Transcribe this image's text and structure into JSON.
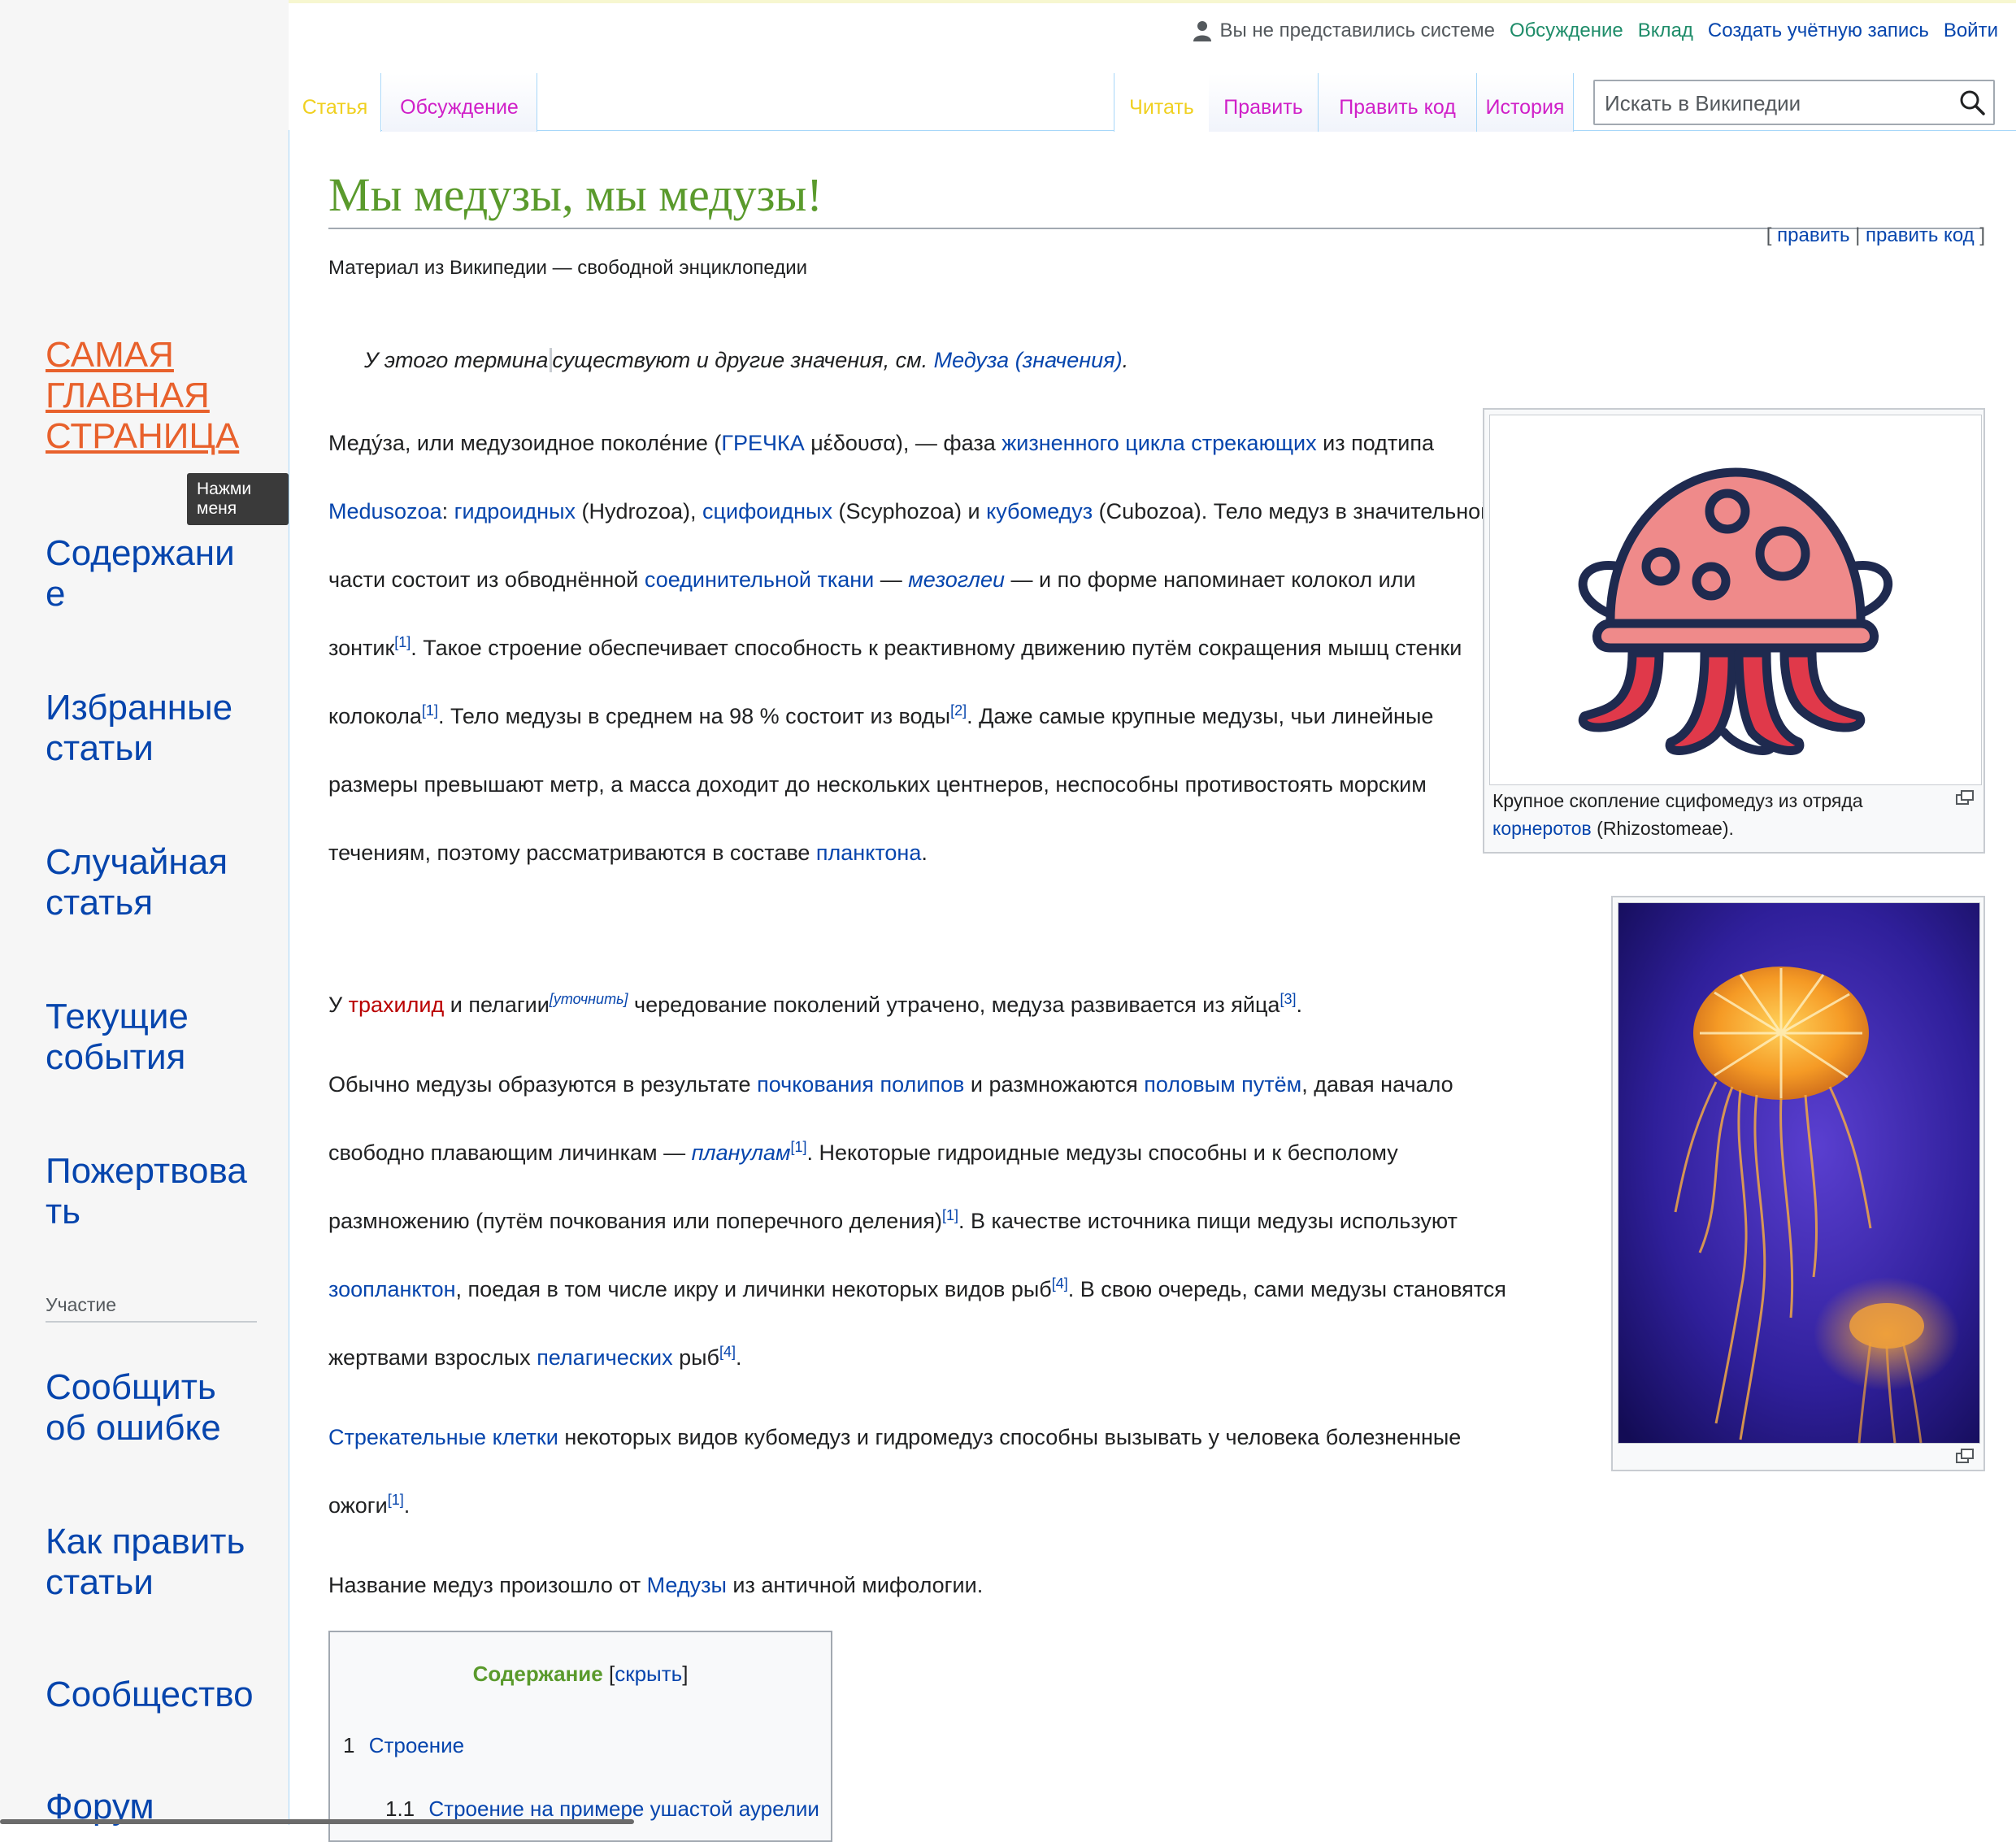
{
  "personal": {
    "anon": "Вы не представились системе",
    "talk": "Обсуждение",
    "contrib": "Вклад",
    "create": "Создать учётную запись",
    "login": "Войти"
  },
  "tabs": {
    "article": "Статья",
    "talk": "Обсуждение",
    "read": "Читать",
    "edit": "Править",
    "edit_source": "Править код",
    "history": "История"
  },
  "search": {
    "placeholder": "Искать в Википедии"
  },
  "sidebar": {
    "main_page": [
      "САМАЯ",
      "ГЛАВНАЯ",
      "СТРАНИЦА"
    ],
    "tooltip": "Нажми меня",
    "contents": [
      "Содержани",
      "е"
    ],
    "featured": [
      "Избранные",
      "статьи"
    ],
    "random": [
      "Случайная",
      "статья"
    ],
    "current": [
      "Текущие",
      "события"
    ],
    "donate": [
      "Пожертвова",
      "ть"
    ],
    "participation_heading": "Участие",
    "report": [
      "Сообщить",
      "об ошибке"
    ],
    "how_edit": [
      "Как править",
      "статьи"
    ],
    "community": "Сообщество",
    "forum": "Форум"
  },
  "article": {
    "title": "Мы медузы, мы медузы!",
    "edit_links": {
      "open": "[",
      "edit": "править",
      "sep": "|",
      "edit_source": "править код",
      "close": "]"
    },
    "tagline": "Материал из Википедии — свободной энциклопедии",
    "hatnote": {
      "text1": "У этого термина",
      "text2": "существуют и другие значения, см.",
      "link": "Медуза (значения)",
      "end": "."
    },
    "p1": {
      "t1": "Меду́за, или медузоидное поколе́ние (",
      "l1": "ГРЕЧКА",
      "t2": " μέδουσα), — фаза ",
      "l2": "жизненного цикла",
      "t3": " ",
      "l3": "стрекающих",
      "t4": " из подтипа ",
      "l4": "Medusozoa",
      "t5": ": ",
      "l5": "гидроидных",
      "t6": " (Hydrozoa), ",
      "l6": "сцифоидных",
      "t7": " (Scyphozoa) и ",
      "l7": "кубомедуз",
      "t8": " (Cubozoa). Тело медуз в значительной части состоит из обводнённой ",
      "l8": "соединительной ткани",
      "t9": " — ",
      "l9": "мезоглеи",
      "t10": " — и по форме напоминает колокол или зонтик",
      "r1": "[1]",
      "t11": ". Такое строение обеспечивает способность к реактивному движению путём сокращения мышц стенки колокола",
      "r2": "[1]",
      "t12": ". Тело медузы в среднем на 98 % состоит из воды",
      "r3": "[2]",
      "t13": ". Даже самые крупные медузы, чьи линейные размеры превышают метр, а масса доходит до нескольких центнеров, неспособны противостоять морским течениям, поэтому рассматриваются в составе ",
      "l10": "планктона",
      "t14": "."
    },
    "p2": {
      "t1": "У ",
      "l1": "трахилид",
      "t2": " и пелагии",
      "clar": "[уточнить]",
      "t3": " чередование поколений утрачено, медуза развивается из яйца",
      "r1": "[3]",
      "t4": "."
    },
    "p3": {
      "t1": "Обычно медузы образуются в результате ",
      "l1": "почкования",
      "t2": " ",
      "l2": "полипов",
      "t3": " и размножаются ",
      "l3": "половым путём",
      "t4": ", давая начало свободно плавающим личинкам — ",
      "l4": "планулам",
      "r1": "[1]",
      "t5": ". Некоторые гидроидные медузы способны и к бесполому размножению (путём почкования или поперечного деления)",
      "r2": "[1]",
      "t6": ". В качестве источника пищи медузы используют ",
      "l5": "зоопланктон",
      "t7": ", поедая в том числе икру и личинки некоторых видов рыб",
      "r3": "[4]",
      "t8": ". В свою очередь, сами медузы становятся жертвами взрослых ",
      "l6": "пелагических",
      "t9": " рыб",
      "r4": "[4]",
      "t10": "."
    },
    "p4": {
      "l1": "Стрекательные клетки",
      "t1": " некоторых видов кубомедуз и гидромедуз способны вызывать у человека болезненные ожоги",
      "r1": "[1]",
      "t2": "."
    },
    "p5": {
      "t1": "Название медуз произошло от ",
      "l1": "Медузы",
      "t2": " из античной мифологии."
    },
    "figure1": {
      "caption1": "Крупное скопление сцифомедуз из отряда ",
      "caption_link": "корнеротов",
      "caption2": " (Rhizostomeae)."
    },
    "toc": {
      "title": "Содержание",
      "toggle_open": "[",
      "toggle": "скрыть",
      "toggle_close": "]",
      "items": [
        {
          "num": "1",
          "label": "Строение"
        },
        {
          "num": "1.1",
          "label": "Строение на примере ушастой аурелии"
        }
      ]
    }
  },
  "colors": {
    "link": "#0645ad",
    "title_green": "#5a9a2c",
    "main_page_orange": "#e8612c",
    "tab_yellow": "#f0d020",
    "tab_magenta": "#d020c8",
    "jelly_pink": "#ef8a8a",
    "jelly_outline": "#1f2a4f",
    "jelly_red": "#e0394a"
  }
}
